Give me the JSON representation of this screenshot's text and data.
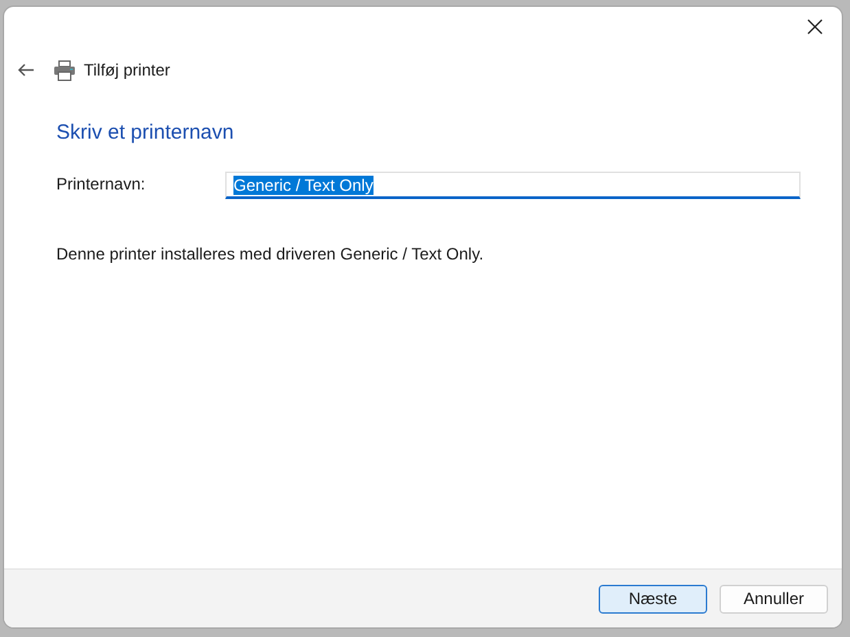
{
  "window": {
    "title": "Tilføj printer"
  },
  "heading": "Skriv et printernavn",
  "printer_name": {
    "label": "Printernavn:",
    "value": "Generic / Text Only",
    "text_selected": true
  },
  "description": "Denne printer installeres med driveren Generic / Text Only.",
  "buttons": [
    {
      "label": "Næste",
      "default": true
    },
    {
      "label": "Annuller",
      "default": false
    }
  ]
}
